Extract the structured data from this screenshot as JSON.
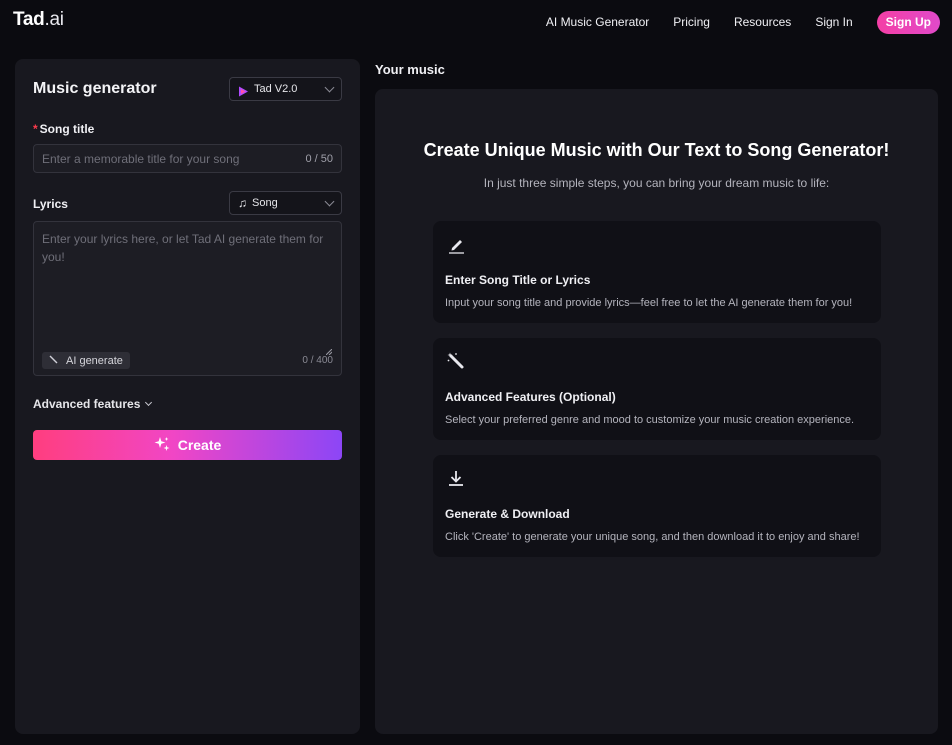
{
  "header": {
    "logo_main": "Tad",
    "logo_suffix": ".ai",
    "nav": [
      "AI Music Generator",
      "Pricing",
      "Resources",
      "Sign In"
    ],
    "signup": "Sign Up"
  },
  "generator": {
    "title": "Music generator",
    "model": "Tad V2.0",
    "song_title_label": "Song title",
    "song_title_required_mark": "*",
    "song_title_placeholder": "Enter a memorable title for your song",
    "song_title_counter": "0 / 50",
    "lyrics_label": "Lyrics",
    "lyrics_mode": "Song",
    "lyrics_placeholder": "Enter your lyrics here, or let Tad AI generate them for you!",
    "ai_generate": "AI generate",
    "lyrics_counter": "0 / 400",
    "advanced": "Advanced features",
    "create": "Create"
  },
  "your_music": {
    "heading": "Your music",
    "title": "Create Unique Music with Our Text to Song Generator!",
    "subtitle": "In just three simple steps, you can bring your dream music to life:",
    "steps": [
      {
        "icon": "pencil-icon",
        "title": "Enter Song Title or Lyrics",
        "desc": "Input your song title and provide lyrics—feel free to let the AI generate them for you!"
      },
      {
        "icon": "magic-wand-icon",
        "title": "Advanced Features (Optional)",
        "desc": "Select your preferred genre and mood to customize your music creation experience."
      },
      {
        "icon": "download-icon",
        "title": "Generate & Download",
        "desc": "Click 'Create' to generate your unique song, and then download it to enjoy and share!"
      }
    ]
  },
  "colors": {
    "background": "#0b0b10",
    "panel": "#18181f",
    "accent_pink": "#f146c5",
    "accent_purple": "#8c46f6",
    "required": "#ff3b4d"
  }
}
